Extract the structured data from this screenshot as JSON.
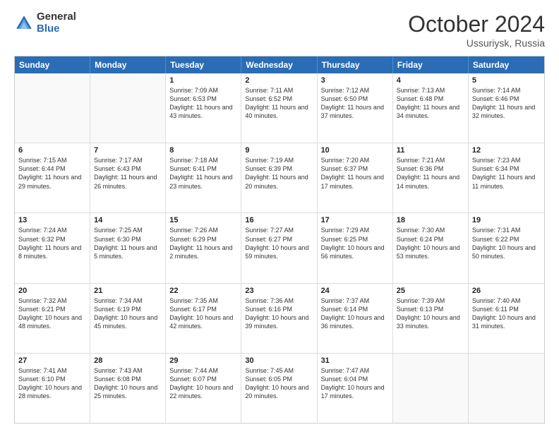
{
  "logo": {
    "general": "General",
    "blue": "Blue"
  },
  "header": {
    "month": "October 2024",
    "location": "Ussuriysk, Russia"
  },
  "weekdays": [
    "Sunday",
    "Monday",
    "Tuesday",
    "Wednesday",
    "Thursday",
    "Friday",
    "Saturday"
  ],
  "rows": [
    [
      {
        "day": "",
        "sunrise": "",
        "sunset": "",
        "daylight": "",
        "empty": true
      },
      {
        "day": "",
        "sunrise": "",
        "sunset": "",
        "daylight": "",
        "empty": true
      },
      {
        "day": "1",
        "sunrise": "Sunrise: 7:09 AM",
        "sunset": "Sunset: 6:53 PM",
        "daylight": "Daylight: 11 hours and 43 minutes."
      },
      {
        "day": "2",
        "sunrise": "Sunrise: 7:11 AM",
        "sunset": "Sunset: 6:52 PM",
        "daylight": "Daylight: 11 hours and 40 minutes."
      },
      {
        "day": "3",
        "sunrise": "Sunrise: 7:12 AM",
        "sunset": "Sunset: 6:50 PM",
        "daylight": "Daylight: 11 hours and 37 minutes."
      },
      {
        "day": "4",
        "sunrise": "Sunrise: 7:13 AM",
        "sunset": "Sunset: 6:48 PM",
        "daylight": "Daylight: 11 hours and 34 minutes."
      },
      {
        "day": "5",
        "sunrise": "Sunrise: 7:14 AM",
        "sunset": "Sunset: 6:46 PM",
        "daylight": "Daylight: 11 hours and 32 minutes."
      }
    ],
    [
      {
        "day": "6",
        "sunrise": "Sunrise: 7:15 AM",
        "sunset": "Sunset: 6:44 PM",
        "daylight": "Daylight: 11 hours and 29 minutes."
      },
      {
        "day": "7",
        "sunrise": "Sunrise: 7:17 AM",
        "sunset": "Sunset: 6:43 PM",
        "daylight": "Daylight: 11 hours and 26 minutes."
      },
      {
        "day": "8",
        "sunrise": "Sunrise: 7:18 AM",
        "sunset": "Sunset: 6:41 PM",
        "daylight": "Daylight: 11 hours and 23 minutes."
      },
      {
        "day": "9",
        "sunrise": "Sunrise: 7:19 AM",
        "sunset": "Sunset: 6:39 PM",
        "daylight": "Daylight: 11 hours and 20 minutes."
      },
      {
        "day": "10",
        "sunrise": "Sunrise: 7:20 AM",
        "sunset": "Sunset: 6:37 PM",
        "daylight": "Daylight: 11 hours and 17 minutes."
      },
      {
        "day": "11",
        "sunrise": "Sunrise: 7:21 AM",
        "sunset": "Sunset: 6:36 PM",
        "daylight": "Daylight: 11 hours and 14 minutes."
      },
      {
        "day": "12",
        "sunrise": "Sunrise: 7:23 AM",
        "sunset": "Sunset: 6:34 PM",
        "daylight": "Daylight: 11 hours and 11 minutes."
      }
    ],
    [
      {
        "day": "13",
        "sunrise": "Sunrise: 7:24 AM",
        "sunset": "Sunset: 6:32 PM",
        "daylight": "Daylight: 11 hours and 8 minutes."
      },
      {
        "day": "14",
        "sunrise": "Sunrise: 7:25 AM",
        "sunset": "Sunset: 6:30 PM",
        "daylight": "Daylight: 11 hours and 5 minutes."
      },
      {
        "day": "15",
        "sunrise": "Sunrise: 7:26 AM",
        "sunset": "Sunset: 6:29 PM",
        "daylight": "Daylight: 11 hours and 2 minutes."
      },
      {
        "day": "16",
        "sunrise": "Sunrise: 7:27 AM",
        "sunset": "Sunset: 6:27 PM",
        "daylight": "Daylight: 10 hours and 59 minutes."
      },
      {
        "day": "17",
        "sunrise": "Sunrise: 7:29 AM",
        "sunset": "Sunset: 6:25 PM",
        "daylight": "Daylight: 10 hours and 56 minutes."
      },
      {
        "day": "18",
        "sunrise": "Sunrise: 7:30 AM",
        "sunset": "Sunset: 6:24 PM",
        "daylight": "Daylight: 10 hours and 53 minutes."
      },
      {
        "day": "19",
        "sunrise": "Sunrise: 7:31 AM",
        "sunset": "Sunset: 6:22 PM",
        "daylight": "Daylight: 10 hours and 50 minutes."
      }
    ],
    [
      {
        "day": "20",
        "sunrise": "Sunrise: 7:32 AM",
        "sunset": "Sunset: 6:21 PM",
        "daylight": "Daylight: 10 hours and 48 minutes."
      },
      {
        "day": "21",
        "sunrise": "Sunrise: 7:34 AM",
        "sunset": "Sunset: 6:19 PM",
        "daylight": "Daylight: 10 hours and 45 minutes."
      },
      {
        "day": "22",
        "sunrise": "Sunrise: 7:35 AM",
        "sunset": "Sunset: 6:17 PM",
        "daylight": "Daylight: 10 hours and 42 minutes."
      },
      {
        "day": "23",
        "sunrise": "Sunrise: 7:36 AM",
        "sunset": "Sunset: 6:16 PM",
        "daylight": "Daylight: 10 hours and 39 minutes."
      },
      {
        "day": "24",
        "sunrise": "Sunrise: 7:37 AM",
        "sunset": "Sunset: 6:14 PM",
        "daylight": "Daylight: 10 hours and 36 minutes."
      },
      {
        "day": "25",
        "sunrise": "Sunrise: 7:39 AM",
        "sunset": "Sunset: 6:13 PM",
        "daylight": "Daylight: 10 hours and 33 minutes."
      },
      {
        "day": "26",
        "sunrise": "Sunrise: 7:40 AM",
        "sunset": "Sunset: 6:11 PM",
        "daylight": "Daylight: 10 hours and 31 minutes."
      }
    ],
    [
      {
        "day": "27",
        "sunrise": "Sunrise: 7:41 AM",
        "sunset": "Sunset: 6:10 PM",
        "daylight": "Daylight: 10 hours and 28 minutes."
      },
      {
        "day": "28",
        "sunrise": "Sunrise: 7:43 AM",
        "sunset": "Sunset: 6:08 PM",
        "daylight": "Daylight: 10 hours and 25 minutes."
      },
      {
        "day": "29",
        "sunrise": "Sunrise: 7:44 AM",
        "sunset": "Sunset: 6:07 PM",
        "daylight": "Daylight: 10 hours and 22 minutes."
      },
      {
        "day": "30",
        "sunrise": "Sunrise: 7:45 AM",
        "sunset": "Sunset: 6:05 PM",
        "daylight": "Daylight: 10 hours and 20 minutes."
      },
      {
        "day": "31",
        "sunrise": "Sunrise: 7:47 AM",
        "sunset": "Sunset: 6:04 PM",
        "daylight": "Daylight: 10 hours and 17 minutes."
      },
      {
        "day": "",
        "sunrise": "",
        "sunset": "",
        "daylight": "",
        "empty": true
      },
      {
        "day": "",
        "sunrise": "",
        "sunset": "",
        "daylight": "",
        "empty": true
      }
    ]
  ]
}
